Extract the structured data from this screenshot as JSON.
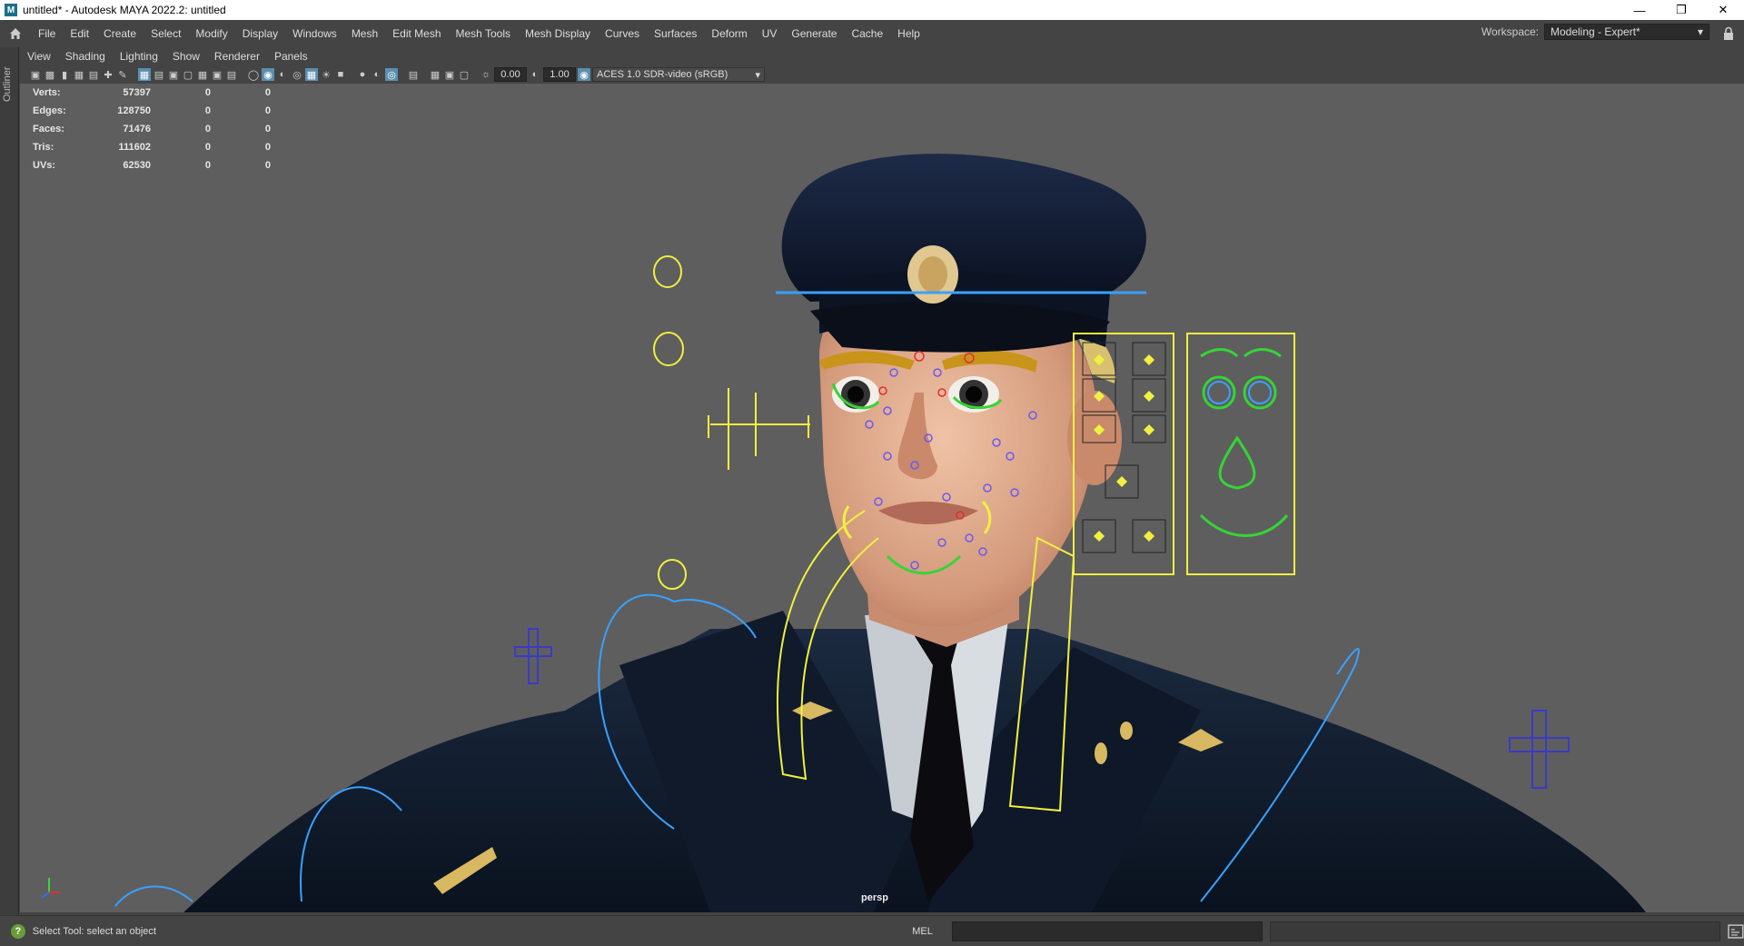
{
  "window": {
    "title": "untitled* - Autodesk MAYA 2022.2: untitled",
    "app_icon": "M",
    "controls": [
      "minimize-icon",
      "restore-icon",
      "close-icon"
    ]
  },
  "menubar": {
    "items": [
      "File",
      "Edit",
      "Create",
      "Select",
      "Modify",
      "Display",
      "Windows",
      "Mesh",
      "Edit Mesh",
      "Mesh Tools",
      "Mesh Display",
      "Curves",
      "Surfaces",
      "Deform",
      "UV",
      "Generate",
      "Cache",
      "Help"
    ],
    "workspace_label": "Workspace:",
    "workspace_value": "Modeling - Expert*"
  },
  "outliner_tab": "Outliner",
  "panel_menu": [
    "View",
    "Shading",
    "Lighting",
    "Show",
    "Renderer",
    "Panels"
  ],
  "panel_toolbar": {
    "exposure": "0.00",
    "gamma": "1.00",
    "color_space": "ACES 1.0 SDR-video (sRGB)"
  },
  "hud": {
    "rows": [
      {
        "label": "Verts:",
        "v1": "57397",
        "v2": "0",
        "v3": "0"
      },
      {
        "label": "Edges:",
        "v1": "128750",
        "v2": "0",
        "v3": "0"
      },
      {
        "label": "Faces:",
        "v1": "71476",
        "v2": "0",
        "v3": "0"
      },
      {
        "label": "Tris:",
        "v1": "111602",
        "v2": "0",
        "v3": "0"
      },
      {
        "label": "UVs:",
        "v1": "62530",
        "v2": "0",
        "v3": "0"
      }
    ]
  },
  "viewport": {
    "camera": "persp"
  },
  "statusbar": {
    "help_text": "Select Tool: select an object",
    "command_language": "MEL"
  },
  "colors": {
    "background": "#5e5e5e",
    "ui_dark": "#444444",
    "control_yellow": "#f0f040",
    "control_green": "#36d436",
    "control_blue": "#3aa0ff",
    "uniform_navy": "#0f1a2c",
    "skin": "#d9a48a"
  }
}
